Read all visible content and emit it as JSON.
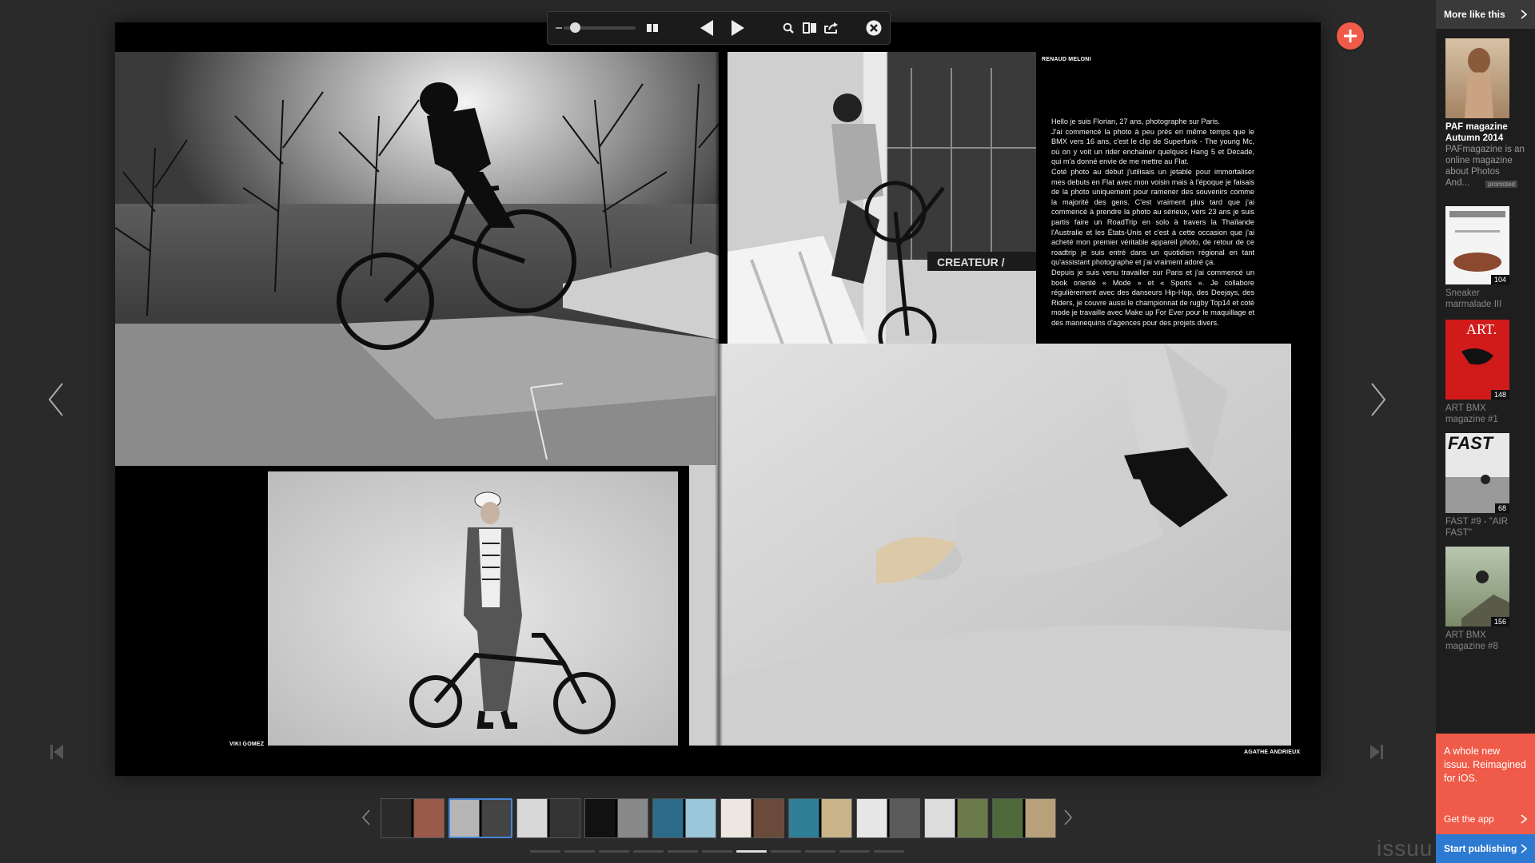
{
  "toolbar": {
    "zoom_icon": "zoom-slider",
    "icons": [
      "columns-icon",
      "previous-page-icon",
      "next-page-icon",
      "search-icon",
      "pages-view-icon",
      "share-icon",
      "close-icon"
    ]
  },
  "spread": {
    "left_caption": "VIKI GOMEZ",
    "right_top_caption": "RENAUD MELONI",
    "right_bottom_caption": "AGATHE ANDRIEUX",
    "overlay_text": "CREATEUR /",
    "article_paragraphs": [
      "Hello je suis Florian, 27 ans, photographe sur Paris.",
      "J'ai commencé la photo à peu près en même temps que le BMX vers 16 ans, c'est le clip de Superfunk - The young Mc, où on y voit un rider enchainer quelques Hang 5 et Decade, qui m'a donné envie de me mettre au Flat.",
      "Coté photo au début j'utilisais un jetable pour immortaliser mes debuts en Flat avec mon voisin mais à l'époque je faisais de la photo uniquement pour ramener des souvenirs comme la majorité des gens. C'est vraiment plus tard que j'ai commencé à prendre la photo au sérieux, vers 23 ans je suis partis faire un RoadTrip en solo à travers la Thaïlande l'Australie et les États-Unis et c'est à cette occasion que j'ai acheté mon premier véritable appareil photo, de retour de ce roadtrip je suis entré dans un quotidien régional en tant qu'assistant photographe et j'ai vraiment adoré ça.",
      "Depuis je suis venu travailler sur Paris et j'ai commencé un book orienté « Mode » et « Sports ». Je collabore régulièrement avec des danseurs Hip-Hop, des Deejays, des Riders, je couvre aussi le championnat de rugby Top14 et coté mode je travaille avec Make up For Ever pour le maquillage et des mannequins d'agences pour des projets divers."
    ]
  },
  "sidebar": {
    "header": "More like this",
    "items": [
      {
        "title": "PAF magazine Autumn 2014",
        "desc": "PAFmagazine is an online magazine about Photos And...",
        "badge": "promoted",
        "count": ""
      },
      {
        "title": "Sneaker marmalade III",
        "desc": "",
        "badge": "",
        "count": "104"
      },
      {
        "title": "ART BMX magazine #1",
        "desc": "",
        "badge": "",
        "count": "148"
      },
      {
        "title": "FAST #9 - \"AIR FAST\"",
        "desc": "",
        "badge": "",
        "count": "68"
      },
      {
        "title": "ART BMX magazine #8",
        "desc": "",
        "badge": "",
        "count": "156"
      }
    ],
    "cover_texts": [
      "ART.",
      "FAST"
    ],
    "promo": {
      "text": "A whole new issuu. Reimagined for iOS.",
      "cta": "Get the app"
    },
    "publish": "Start publishing",
    "logo": "issuu"
  },
  "thumbnails": {
    "count": 10,
    "active_index": 1,
    "labels": [
      "",
      "",
      "",
      "",
      "",
      "",
      "",
      "",
      "",
      ""
    ]
  },
  "page_indicator": {
    "count": 11,
    "active_index": 6
  },
  "colors": {
    "accent_red": "#f05a48",
    "accent_blue": "#2d7ad2",
    "active_thumb": "#4a86d8"
  }
}
